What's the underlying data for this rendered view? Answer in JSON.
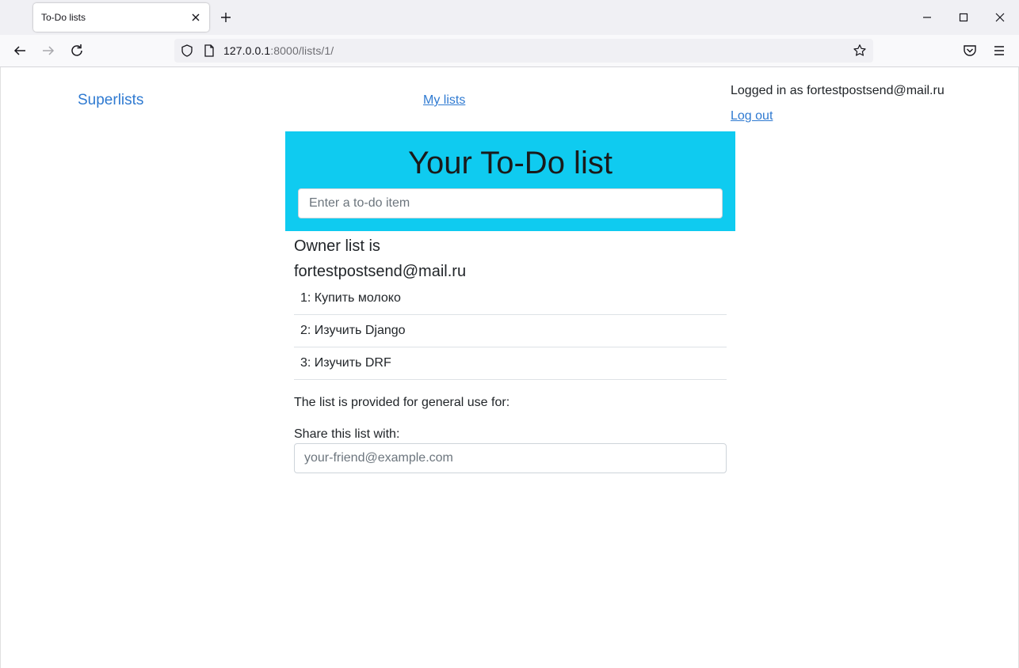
{
  "browser": {
    "tab_title": "To-Do lists",
    "url_host": "127.0.0.1",
    "url_rest": ":8000/lists/1/"
  },
  "header": {
    "brand": "Superlists",
    "my_lists": "My lists",
    "logged_in": "Logged in as fortestpostsend@mail.ru",
    "log_out": "Log out"
  },
  "jumbotron": {
    "title": "Your To-Do list",
    "input_placeholder": "Enter a to-do item",
    "background_color": "#0fcbf0"
  },
  "owner": {
    "label": "Owner list is",
    "email": "fortestpostsend@mail.ru"
  },
  "items": [
    "1: Купить молоко",
    "2: Изучить Django",
    "3: Изучить DRF"
  ],
  "sharing": {
    "general_use_text": "The list is provided for general use for:",
    "share_label": "Share this list with:",
    "share_placeholder": "your-friend@example.com"
  },
  "colors": {
    "link": "#2f7ad1"
  },
  "icons": {
    "tab_close": "close-icon",
    "new_tab": "plus-icon",
    "minimize": "minimize-icon",
    "maximize": "maximize-icon",
    "close_window": "close-window-icon",
    "back": "back-arrow-icon",
    "forward": "forward-arrow-icon",
    "reload": "reload-icon",
    "tracking": "shield-icon",
    "page": "page-icon",
    "bookmark": "star-icon",
    "pocket": "pocket-icon",
    "menu": "hamburger-menu-icon"
  }
}
